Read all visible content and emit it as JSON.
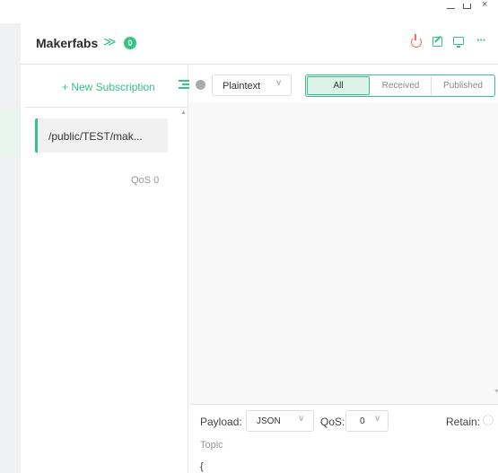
{
  "window": {
    "close_glyph": "×"
  },
  "connection": {
    "name": "Makerfabs",
    "collapse_glyph": "≫",
    "badge": "0"
  },
  "toolbar": {
    "more_glyph": "···"
  },
  "subscriptions": {
    "new_label": "+ New Subscription",
    "items": [
      {
        "topic": "/public/TEST/mak...",
        "qos": "QoS 0",
        "color": "#34c388"
      }
    ]
  },
  "messages": {
    "format": "Plaintext",
    "tabs": [
      "All",
      "Received",
      "Published"
    ],
    "active_tab": "All"
  },
  "compose": {
    "payload_label": "Payload:",
    "payload_type": "JSON",
    "qos_label": "QoS:",
    "qos_value": "0",
    "retain_label": "Retain:",
    "topic_placeholder": "Topic",
    "payload_text": "{"
  },
  "glyphs": {
    "chevron": "∨",
    "scroll_up": "▲",
    "scroll_down": "▼"
  },
  "colors": {
    "accent": "#34c388",
    "danger": "#f56c6c"
  },
  "icons": [
    "minimize-icon",
    "maximize-icon",
    "close-icon",
    "double-chevron-icon",
    "power-icon",
    "edit-icon",
    "screen-icon",
    "more-icon",
    "filter-icon",
    "status-dot"
  ]
}
